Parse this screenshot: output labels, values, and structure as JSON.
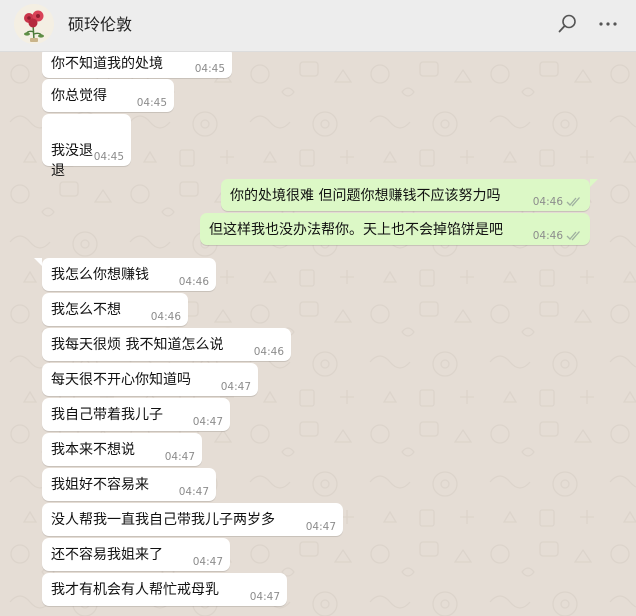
{
  "header": {
    "contact_name": "硕玲伦敦",
    "avatar_icon": "rose-avatar-icon",
    "search_icon": "search-icon",
    "more_icon": "more-options-icon"
  },
  "colors": {
    "chat_background": "#e5ddd5",
    "incoming_bubble": "#ffffff",
    "outgoing_bubble": "#dcf8c6",
    "read_ticks": "#4fc3f7"
  },
  "messages": [
    {
      "direction": "in",
      "text": "你不知道我的处境",
      "time": "04:45"
    },
    {
      "direction": "in",
      "text": "你总觉得",
      "time": "04:45"
    },
    {
      "direction": "in",
      "text": "我没退\n退",
      "time": "04:45"
    },
    {
      "direction": "out",
      "text": "你的处境很难  但问题你想赚钱不应该努力吗",
      "time": "04:46"
    },
    {
      "direction": "out",
      "text": "但这样我也没办法帮你。天上也不会掉馅饼是吧",
      "time": "04:46"
    },
    {
      "direction": "in",
      "text": "我怎么你想赚钱",
      "time": "04:46"
    },
    {
      "direction": "in",
      "text": "我怎么不想",
      "time": "04:46"
    },
    {
      "direction": "in",
      "text": "我每天很烦 我不知道怎么说",
      "time": "04:46"
    },
    {
      "direction": "in",
      "text": "每天很不开心你知道吗",
      "time": "04:47"
    },
    {
      "direction": "in",
      "text": "我自己带着我儿子",
      "time": "04:47"
    },
    {
      "direction": "in",
      "text": "我本来不想说",
      "time": "04:47"
    },
    {
      "direction": "in",
      "text": "我姐好不容易来",
      "time": "04:47"
    },
    {
      "direction": "in",
      "text": "没人帮我一直我自己带我儿子两岁多",
      "time": "04:47"
    },
    {
      "direction": "in",
      "text": "还不容易我姐来了",
      "time": "04:47"
    },
    {
      "direction": "in",
      "text": "我才有机会有人帮忙戒母乳",
      "time": "04:47"
    }
  ]
}
